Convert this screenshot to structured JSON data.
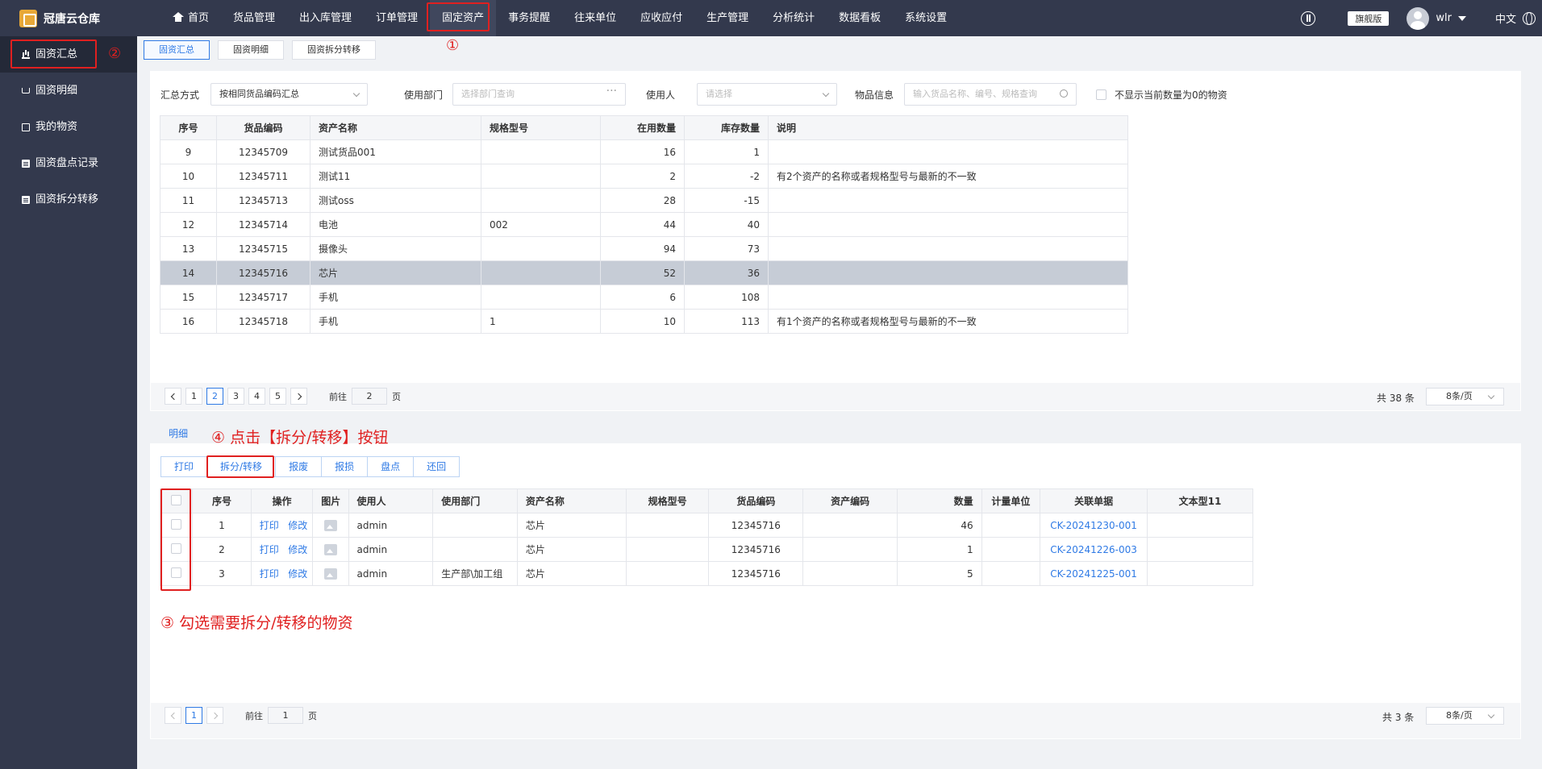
{
  "app": {
    "name": "冠唐云仓库"
  },
  "nav": {
    "items": [
      "首页",
      "货品管理",
      "出入库管理",
      "订单管理",
      "固定资产",
      "事务提醒",
      "往来单位",
      "应收应付",
      "生产管理",
      "分析统计",
      "数据看板",
      "系统设置"
    ],
    "active": 4
  },
  "header": {
    "edition": "旗舰版",
    "user": "wlr",
    "lang": "中文"
  },
  "sidebar": {
    "items": [
      {
        "label": "固资汇总",
        "icon": "bar-chart-icon"
      },
      {
        "label": "固资明细",
        "icon": "cart-icon"
      },
      {
        "label": "我的物资",
        "icon": "bag-icon"
      },
      {
        "label": "固资盘点记录",
        "icon": "clipboard-icon"
      },
      {
        "label": "固资拆分转移",
        "icon": "clipboard-icon"
      }
    ]
  },
  "tabs": [
    "固资汇总",
    "固资明细",
    "固资拆分转移"
  ],
  "filters": {
    "mode_label": "汇总方式",
    "mode_value": "按相同货品编码汇总",
    "dept_label": "使用部门",
    "dept_placeholder": "选择部门查询",
    "user_label": "使用人",
    "user_placeholder": "请选择",
    "item_label": "物品信息",
    "item_placeholder": "输入货品名称、编号、规格查询",
    "hide_zero_label": "不显示当前数量为0的物资"
  },
  "summary_table": {
    "headers": [
      "序号",
      "货品编码",
      "资产名称",
      "规格型号",
      "在用数量",
      "库存数量",
      "说明"
    ],
    "rows": [
      [
        "9",
        "12345709",
        "测试货品001",
        "",
        "16",
        "1",
        ""
      ],
      [
        "10",
        "12345711",
        "测试11",
        "",
        "2",
        "-2",
        "有2个资产的名称或者规格型号与最新的不一致"
      ],
      [
        "11",
        "12345713",
        "测试oss",
        "",
        "28",
        "-15",
        ""
      ],
      [
        "12",
        "12345714",
        "电池",
        "002",
        "44",
        "40",
        ""
      ],
      [
        "13",
        "12345715",
        "摄像头",
        "",
        "94",
        "73",
        ""
      ],
      [
        "14",
        "12345716",
        "芯片",
        "",
        "52",
        "36",
        ""
      ],
      [
        "15",
        "12345717",
        "手机",
        "",
        "6",
        "108",
        ""
      ],
      [
        "16",
        "12345718",
        "手机",
        "1",
        "10",
        "113",
        "有1个资产的名称或者规格型号与最新的不一致"
      ]
    ],
    "selected_row": 5
  },
  "pager1": {
    "pages": [
      "1",
      "2",
      "3",
      "4",
      "5"
    ],
    "current": 1,
    "goto_prefix": "前往",
    "goto_value": "2",
    "goto_suffix": "页",
    "total": "共 38 条",
    "page_size": "8条/页"
  },
  "detail_tab": "明细",
  "toolbar": {
    "buttons": [
      "打印",
      "拆分/转移",
      "报废",
      "报损",
      "盘点",
      "还回"
    ]
  },
  "detail_table": {
    "headers": [
      "",
      "序号",
      "操作",
      "图片",
      "使用人",
      "使用部门",
      "资产名称",
      "规格型号",
      "货品编码",
      "资产编码",
      "数量",
      "计量单位",
      "关联单据",
      "文本型11"
    ],
    "action_print": "打印",
    "action_edit": "修改",
    "rows": [
      {
        "no": "1",
        "user": "admin",
        "dept": "",
        "name": "芯片",
        "spec": "",
        "code": "12345716",
        "asset_code": "",
        "qty": "46",
        "unit": "",
        "doc": "CK-20241230-001",
        "text11": ""
      },
      {
        "no": "2",
        "user": "admin",
        "dept": "",
        "name": "芯片",
        "spec": "",
        "code": "12345716",
        "asset_code": "",
        "qty": "1",
        "unit": "",
        "doc": "CK-20241226-003",
        "text11": ""
      },
      {
        "no": "3",
        "user": "admin",
        "dept": "生产部\\加工组",
        "name": "芯片",
        "spec": "",
        "code": "12345716",
        "asset_code": "",
        "qty": "5",
        "unit": "",
        "doc": "CK-20241225-001",
        "text11": ""
      }
    ]
  },
  "pager2": {
    "pages": [
      "1"
    ],
    "current": 0,
    "goto_prefix": "前往",
    "goto_value": "1",
    "goto_suffix": "页",
    "total": "共 3 条",
    "page_size": "8条/页"
  },
  "annotations": {
    "n1": "①",
    "n2": "②",
    "n3": "③ 勾选需要拆分/转移的物资",
    "n4": "④ 点击【拆分/转移】按钮"
  },
  "colors": {
    "accent": "#2f7ae5",
    "nav_bg": "#33394d",
    "annotation": "#e02020"
  }
}
